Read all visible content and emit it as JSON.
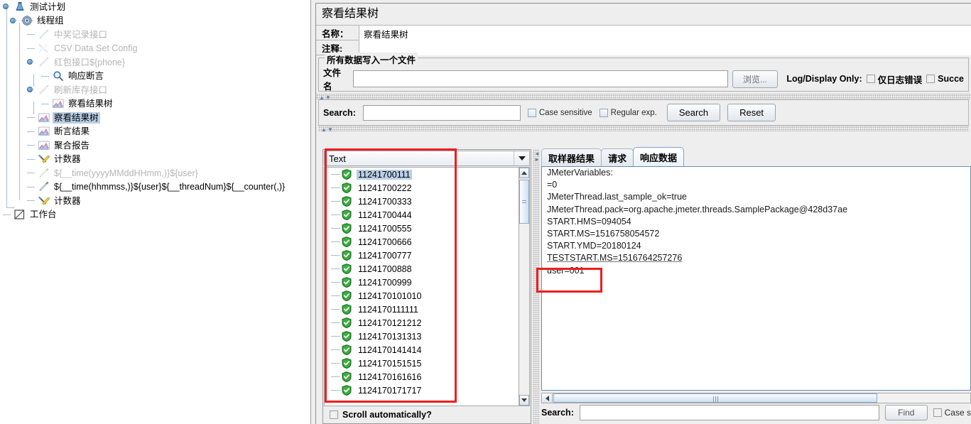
{
  "tree": {
    "items": [
      {
        "label": "测试计划",
        "icon": "test-plan-icon",
        "depth": 0,
        "disabled": false,
        "selected": false
      },
      {
        "label": "线程组",
        "icon": "thread-group-icon",
        "depth": 1,
        "disabled": false,
        "selected": false
      },
      {
        "label": "中奖记录接口",
        "icon": "http-sampler-icon",
        "depth": 2,
        "disabled": true,
        "selected": false
      },
      {
        "label": "CSV Data Set Config",
        "icon": "csv-config-icon",
        "depth": 2,
        "disabled": true,
        "selected": false
      },
      {
        "label": "红包接口${phone}",
        "icon": "http-sampler-icon",
        "depth": 2,
        "disabled": true,
        "selected": false
      },
      {
        "label": "响应断言",
        "icon": "assertion-icon",
        "depth": 3,
        "disabled": false,
        "selected": false
      },
      {
        "label": "刷新库存接口",
        "icon": "http-sampler-icon",
        "depth": 2,
        "disabled": true,
        "selected": false
      },
      {
        "label": "察看结果树",
        "icon": "listener-icon",
        "depth": 3,
        "disabled": false,
        "selected": false
      },
      {
        "label": "察看结果树",
        "icon": "listener-icon",
        "depth": 2,
        "disabled": false,
        "selected": true
      },
      {
        "label": "断言结果",
        "icon": "listener-icon",
        "depth": 2,
        "disabled": false,
        "selected": false
      },
      {
        "label": "聚合报告",
        "icon": "listener-icon",
        "depth": 2,
        "disabled": false,
        "selected": false
      },
      {
        "label": "计数器",
        "icon": "counter-icon",
        "depth": 2,
        "disabled": false,
        "selected": false
      },
      {
        "label": "${__time(yyyyMMddHHmm,)}${user}",
        "icon": "preprocessor-icon",
        "depth": 2,
        "disabled": true,
        "selected": false
      },
      {
        "label": "${__time(hhmmss,)}${user}${__threadNum}${__counter(,)}",
        "icon": "preprocessor-icon",
        "depth": 2,
        "disabled": false,
        "selected": false
      },
      {
        "label": "计数器",
        "icon": "counter-icon",
        "depth": 2,
        "disabled": false,
        "selected": false
      },
      {
        "label": "工作台",
        "icon": "workbench-icon",
        "depth": 0,
        "disabled": false,
        "selected": false
      }
    ]
  },
  "panel": {
    "title": "察看结果树",
    "name_label": "名称：",
    "name_value": "察看结果树",
    "comment_label": "注释:",
    "comment_value": "",
    "group_legend": "所有数据写入一个文件",
    "filename_label": "文件名",
    "filename_value": "",
    "filename_placeholder": "",
    "browse_label": "浏览...",
    "logdisplay_label": "Log/Display Only:",
    "errors_only_label": "仅日志错误",
    "successes_label": "Succe"
  },
  "search_top": {
    "label": "Search:",
    "value": "",
    "case_sensitive_label": "Case sensitive",
    "regular_exp_label": "Regular exp.",
    "search_button": "Search",
    "reset_button": "Reset"
  },
  "list_pane": {
    "render_selector": "Text",
    "scroll_automatically_label": "Scroll automatically?",
    "items": [
      {
        "text": "11241700111",
        "status": "success",
        "selected": true
      },
      {
        "text": "11241700222",
        "status": "success",
        "selected": false
      },
      {
        "text": "11241700333",
        "status": "success",
        "selected": false
      },
      {
        "text": "11241700444",
        "status": "success",
        "selected": false
      },
      {
        "text": "11241700555",
        "status": "success",
        "selected": false
      },
      {
        "text": "11241700666",
        "status": "success",
        "selected": false
      },
      {
        "text": "11241700777",
        "status": "success",
        "selected": false
      },
      {
        "text": "11241700888",
        "status": "success",
        "selected": false
      },
      {
        "text": "11241700999",
        "status": "success",
        "selected": false
      },
      {
        "text": "1124170101010",
        "status": "success",
        "selected": false
      },
      {
        "text": "1124170111111",
        "status": "success",
        "selected": false
      },
      {
        "text": "1124170121212",
        "status": "success",
        "selected": false
      },
      {
        "text": "1124170131313",
        "status": "success",
        "selected": false
      },
      {
        "text": "1124170141414",
        "status": "success",
        "selected": false
      },
      {
        "text": "1124170151515",
        "status": "success",
        "selected": false
      },
      {
        "text": "1124170161616",
        "status": "success",
        "selected": false
      },
      {
        "text": "1124170171717",
        "status": "success",
        "selected": false
      }
    ]
  },
  "tabs": [
    {
      "label": "取样器结果",
      "active": false
    },
    {
      "label": "请求",
      "active": false
    },
    {
      "label": "响应数据",
      "active": true
    }
  ],
  "response": {
    "lines": [
      "JMeterVariables:",
      "=0",
      "JMeterThread.last_sample_ok=true",
      "JMeterThread.pack=org.apache.jmeter.threads.SamplePackage@428d37ae",
      "START.HMS=094054",
      "START.MS=1516758054572",
      "START.YMD=20180124",
      "TESTSTART.MS=1516764257276",
      "user=001"
    ],
    "highlighted_line": "user=001"
  },
  "search_bottom": {
    "label": "Search:",
    "value": "",
    "find_button": "Find",
    "case_label": "Case s"
  },
  "colors": {
    "annotation": "#f01d1d",
    "selection": "#b8cfe5",
    "panel_bg": "#eeeeee",
    "success": "#2f9e34"
  }
}
